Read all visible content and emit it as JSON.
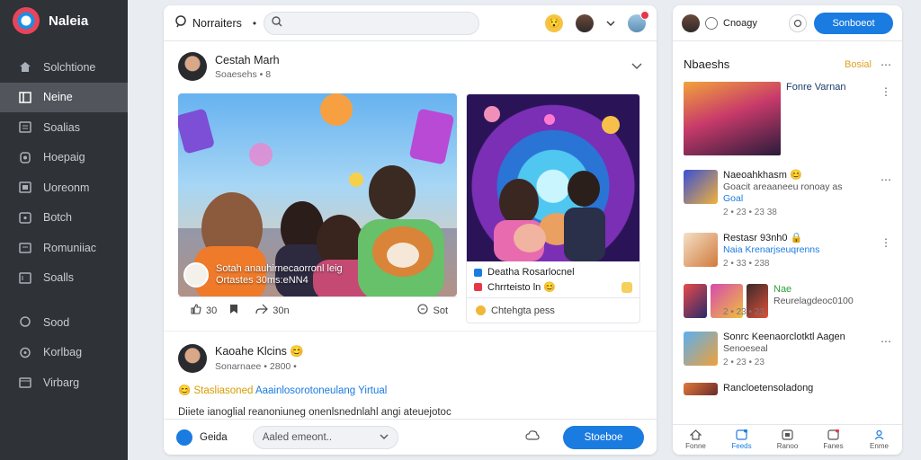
{
  "brand": {
    "name": "Naleia"
  },
  "sidebar": {
    "items": [
      {
        "label": "Solchtione",
        "icon": "home-icon"
      },
      {
        "label": "Neine",
        "icon": "grid-icon",
        "active": true
      },
      {
        "label": "Soalias",
        "icon": "list-icon"
      },
      {
        "label": "Hoepaig",
        "icon": "shield-icon"
      },
      {
        "label": "Uoreonm",
        "icon": "calendar-icon"
      },
      {
        "label": "Botch",
        "icon": "chat-icon"
      },
      {
        "label": "Romuniiac",
        "icon": "folder-icon"
      },
      {
        "label": "Soalls",
        "icon": "settings-icon"
      },
      {
        "label": "Sood",
        "icon": "bulb-icon"
      },
      {
        "label": "Korlbag",
        "icon": "sliders-icon"
      },
      {
        "label": "Virbarg",
        "icon": "bag-icon"
      }
    ]
  },
  "topbar": {
    "workspace": "Norraiters",
    "dot": "•",
    "search_placeholder": ""
  },
  "post1": {
    "author": "Cestah Marh",
    "meta": "Soaesehs • 8",
    "caption_line1": "Sotah anauhirnecaorronl leig",
    "caption_line2": "Ortastes 30ms:eNN4",
    "right_card_title": "Deatha Rosarlocnel",
    "right_card_sub": "Chrrteisto ln 😊",
    "right_foot": "Chtehgta pess",
    "actions": {
      "like": "30",
      "comment": "",
      "share": "30n",
      "save": "Sot"
    }
  },
  "post2": {
    "author": "Kaoahe Klcins 😊",
    "meta": "Sonarnaee • 2800 •",
    "line1_yellow": "😊 Stasliasoned",
    "line1_blue": "Aaainlosorotoneulang Yirtual",
    "line2": "Diiete ianoglial reanoniuneg onenlsnednlahl angi ateuejotoc"
  },
  "composer": {
    "label": "Geida",
    "select_value": "Aaled emeont..",
    "send_label": "Stoeboe"
  },
  "right": {
    "top_label": "Cnoagy",
    "top_button": "Sonboeot",
    "header_title": "Nbaeshs",
    "header_link": "Bosial",
    "feed": [
      {
        "title": "Fonre Varnan",
        "sub": "",
        "meta": ""
      },
      {
        "title": "Naeoahkhasm 😊",
        "sub": "Goacit areaaneeu ronoay as",
        "sub2": "Goal",
        "meta": "2 • 23 • 23 38"
      },
      {
        "title": "Restasr 93nh0 🔒",
        "sub": "Naia Krenarjseuqrenns",
        "meta": "2 • 33 • 238"
      },
      {
        "title": "Nae",
        "sub": "Reurelagdeoc0100",
        "meta": "2 • 23 • 23"
      },
      {
        "title": "Sonrc Keenaorclotktl Aagen",
        "sub": "Senoeseal",
        "meta": "2 • 23 • 23"
      },
      {
        "title": "Rancloetensoladong",
        "sub": "",
        "meta": ""
      }
    ],
    "bottom_nav": [
      {
        "label": "Fonne",
        "icon": "home-icon"
      },
      {
        "label": "Feeds",
        "icon": "feed-icon",
        "active": true
      },
      {
        "label": "Ranoo",
        "icon": "image-icon"
      },
      {
        "label": "Fanes",
        "icon": "inbox-icon"
      },
      {
        "label": "Enme",
        "icon": "profile-icon"
      }
    ]
  },
  "colors": {
    "accent": "#1a7be0",
    "sidebar_bg": "#2f3237",
    "link_gold": "#e0a021"
  }
}
